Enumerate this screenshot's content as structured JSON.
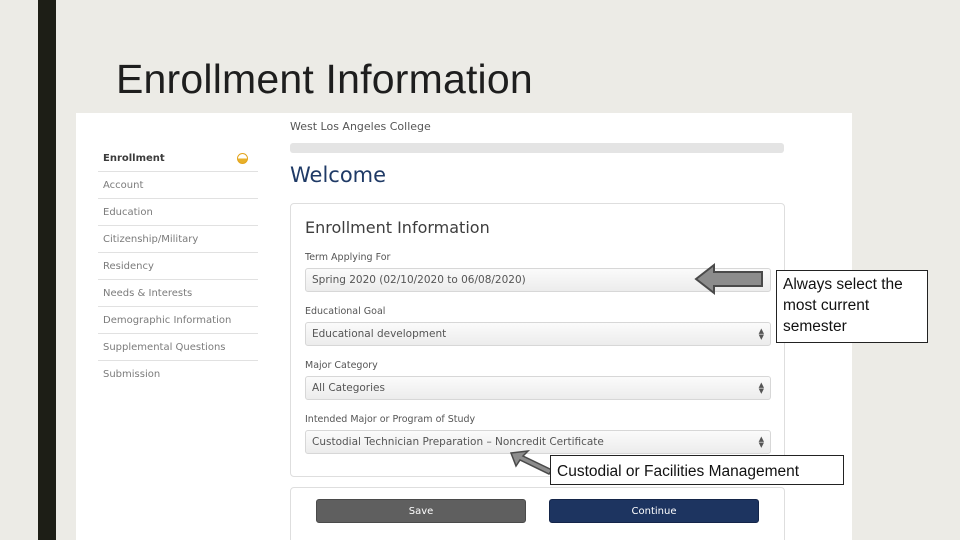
{
  "slide": {
    "title": "Enrollment Information"
  },
  "app": {
    "college_name": "West Los Angeles College",
    "welcome": "Welcome"
  },
  "sidebar": {
    "items": [
      {
        "label": "Enrollment",
        "active": true
      },
      {
        "label": "Account"
      },
      {
        "label": "Education"
      },
      {
        "label": "Citizenship/Military"
      },
      {
        "label": "Residency"
      },
      {
        "label": "Needs & Interests"
      },
      {
        "label": "Demographic Information"
      },
      {
        "label": "Supplemental Questions"
      },
      {
        "label": "Submission"
      }
    ]
  },
  "form": {
    "title": "Enrollment Information",
    "term": {
      "label": "Term Applying For",
      "value": "Spring 2020 (02/10/2020 to 06/08/2020)"
    },
    "goal": {
      "label": "Educational Goal",
      "value": "Educational development"
    },
    "major_category": {
      "label": "Major Category",
      "value": "All Categories"
    },
    "major": {
      "label": "Intended Major or Program of Study",
      "value": "Custodial Technician Preparation – Noncredit Certificate"
    }
  },
  "buttons": {
    "save": "Save",
    "continue": "Continue"
  },
  "callouts": {
    "semester": "Always select the most current semester",
    "custodial": "Custodial or Facilities Management"
  },
  "colors": {
    "accent_navy": "#1d3460",
    "welcome_blue": "#1f3a66",
    "indicator_gold": "#e3a41c"
  }
}
